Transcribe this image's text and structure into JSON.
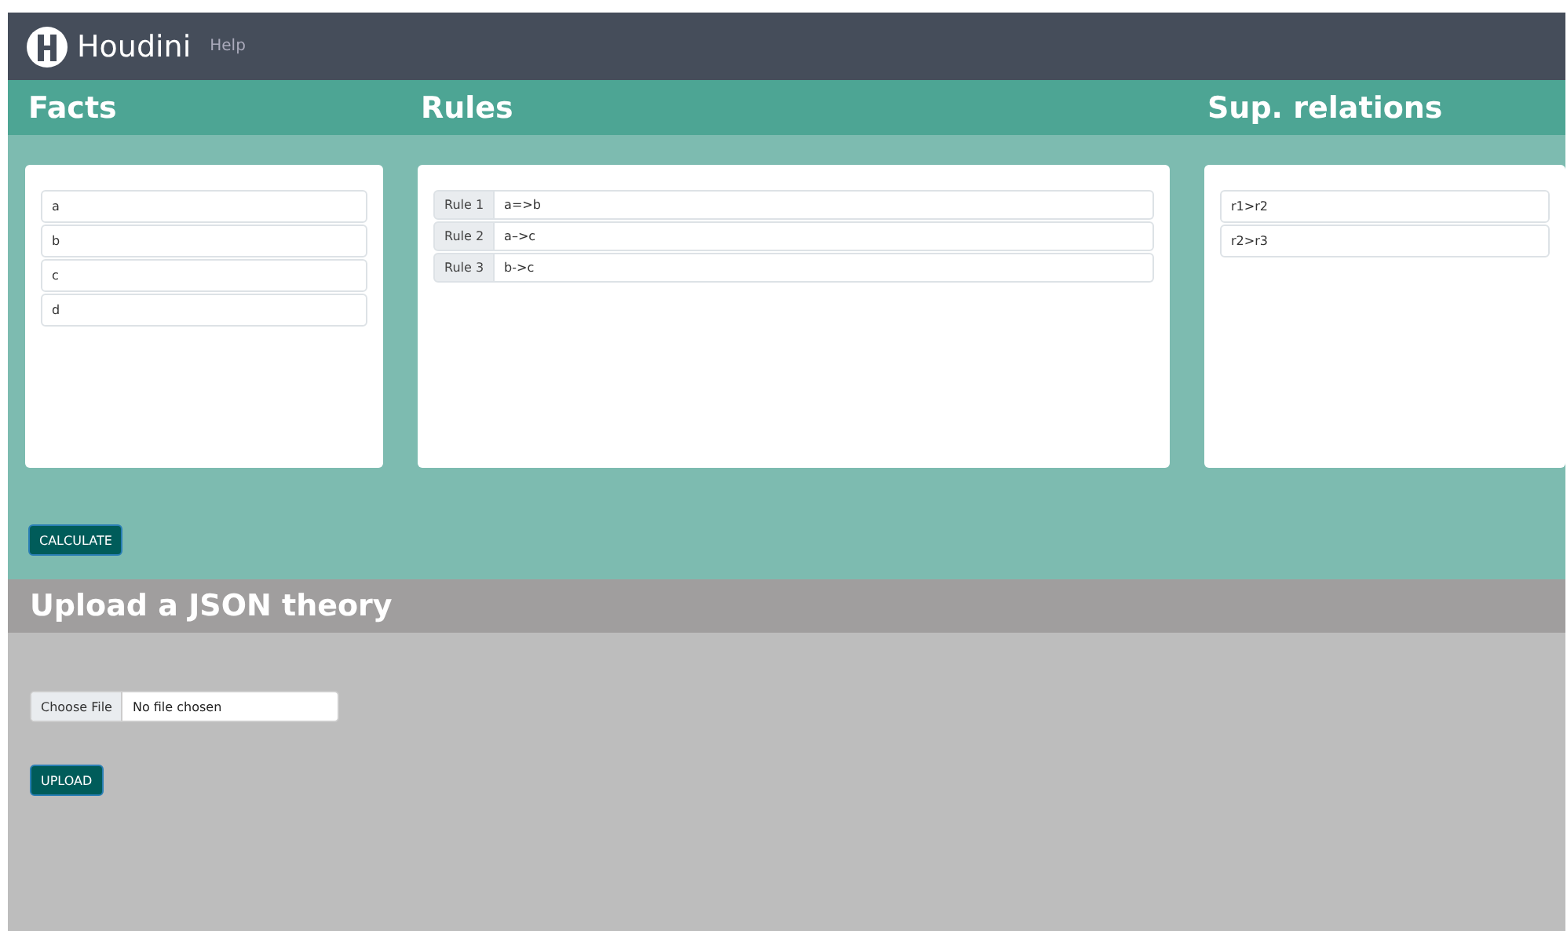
{
  "navbar": {
    "brand": "Houdini",
    "links": [
      "Help"
    ]
  },
  "sections": {
    "facts": {
      "title": "Facts",
      "items": [
        "a",
        "b",
        "c",
        "d"
      ]
    },
    "rules": {
      "title": "Rules",
      "items": [
        {
          "label": "Rule 1",
          "value": "a=>b"
        },
        {
          "label": "Rule 2",
          "value": "a–>c"
        },
        {
          "label": "Rule 3",
          "value": "b->c"
        }
      ]
    },
    "sup_relations": {
      "title": "Sup. relations",
      "items": [
        "r1>r2",
        "r2>r3"
      ]
    }
  },
  "calculate_button": "CALCULATE",
  "upload": {
    "title": "Upload a JSON theory",
    "choose_button": "Choose File",
    "file_status": "No file chosen",
    "upload_button": "UPLOAD"
  }
}
